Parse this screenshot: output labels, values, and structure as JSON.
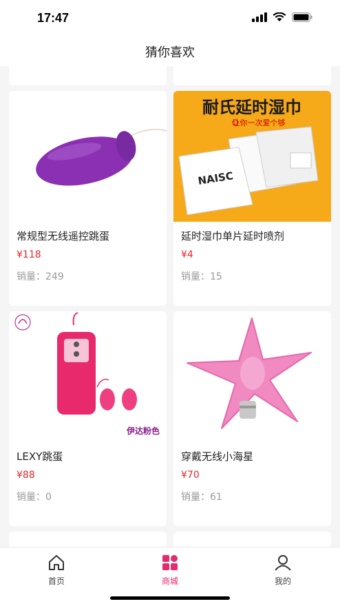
{
  "status": {
    "time": "17:47"
  },
  "nav": {
    "title": "猜你喜欢"
  },
  "products": [
    {
      "name": "常规型无线遥控跳蛋",
      "price": "¥118",
      "sales_label": "销量：",
      "sales": "249"
    },
    {
      "name": "延时湿巾单片延时喷剂",
      "price": "¥4",
      "sales_label": "销量：",
      "sales": "15",
      "image_text": {
        "headline": "耐氏延时湿巾",
        "tagline": "让你一次爱个够",
        "brand": "NAISC"
      }
    },
    {
      "name": "LEXY跳蛋",
      "price": "¥88",
      "sales_label": "销量：",
      "sales": "0",
      "image_text": {
        "corner": "伊达粉色"
      }
    },
    {
      "name": "穿戴无线小海星",
      "price": "¥70",
      "sales_label": "销量：",
      "sales": "61"
    }
  ],
  "tabs": [
    {
      "label": "首页",
      "active": false
    },
    {
      "label": "商城",
      "active": true
    },
    {
      "label": "我的",
      "active": false
    }
  ],
  "colors": {
    "accent": "#e8296b",
    "price": "#e8262a"
  }
}
